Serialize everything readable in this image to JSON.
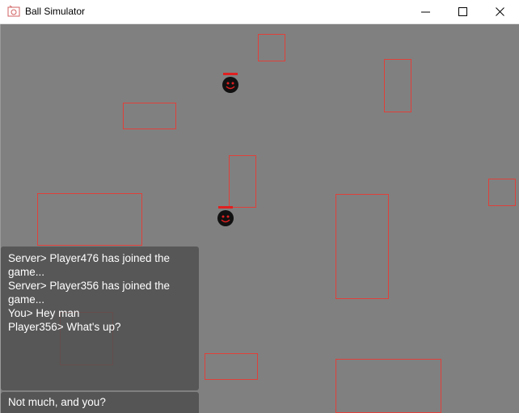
{
  "window": {
    "title": "Ball Simulator",
    "icon": "ball-simulator-app-icon",
    "controls": [
      "minimize-icon",
      "maximize-icon",
      "close-icon"
    ]
  },
  "game": {
    "background_color": "#808080",
    "obstacle_color": "#e0403a",
    "player_color": "#111111",
    "player_face_color": "#e02020"
  },
  "chat": {
    "messages": [
      "Server> Player476 has joined the game...",
      "Server> Player356 has joined the game...",
      "You> Hey man",
      "Player356> What's up?"
    ],
    "input_value": "Not much, and you?"
  }
}
